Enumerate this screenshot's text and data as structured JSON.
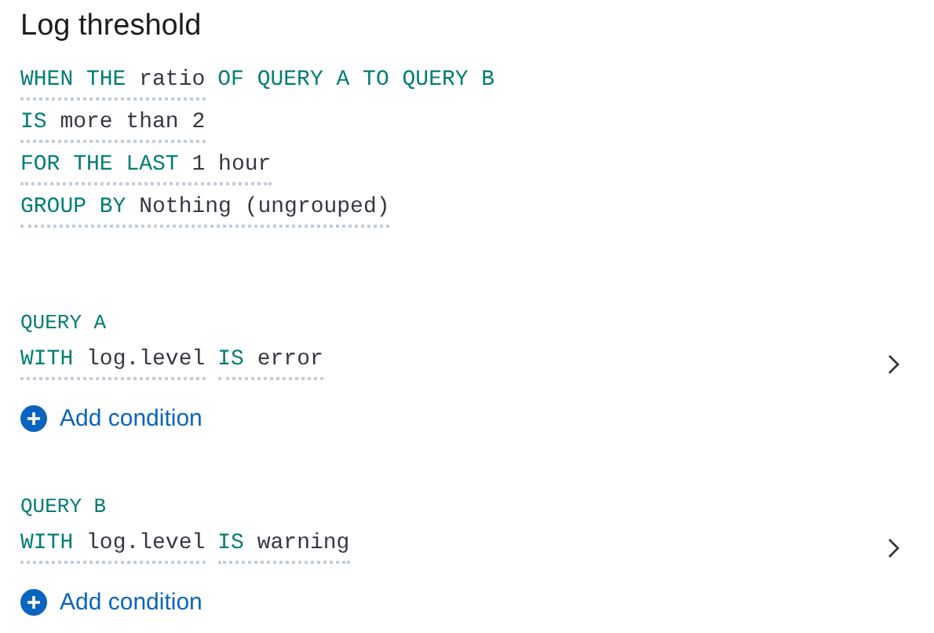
{
  "title": "Log threshold",
  "criteria": [
    {
      "keyword": "WHEN THE",
      "value": "ratio",
      "suffix": "OF QUERY A TO QUERY B"
    },
    {
      "keyword": "IS",
      "value": "more than 2"
    },
    {
      "keyword": "FOR THE LAST",
      "value": "1 hour"
    },
    {
      "keyword": "GROUP BY",
      "value": "Nothing (ungrouped)"
    }
  ],
  "queries": [
    {
      "label": "QUERY A",
      "conditions": [
        {
          "keyword": "WITH",
          "value": "log.level"
        },
        {
          "keyword": "IS",
          "value": "error"
        }
      ],
      "add_label": "Add condition"
    },
    {
      "label": "QUERY B",
      "conditions": [
        {
          "keyword": "WITH",
          "value": "log.level"
        },
        {
          "keyword": "IS",
          "value": "warning"
        }
      ],
      "add_label": "Add condition"
    }
  ]
}
